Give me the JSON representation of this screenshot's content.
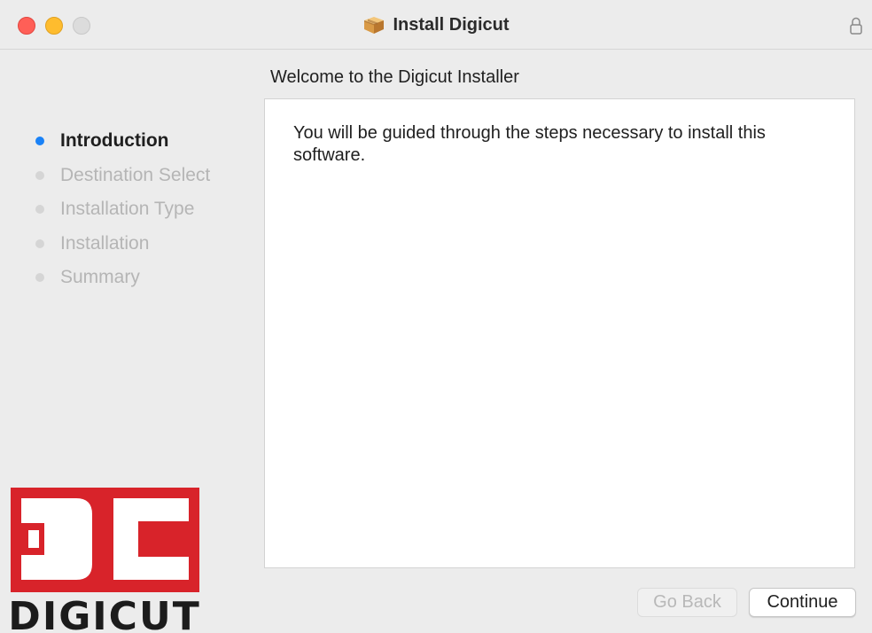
{
  "window": {
    "title": "Install Digicut"
  },
  "heading": "Welcome to the Digicut Installer",
  "steps": [
    {
      "label": "Introduction",
      "active": true
    },
    {
      "label": "Destination Select",
      "active": false
    },
    {
      "label": "Installation Type",
      "active": false
    },
    {
      "label": "Installation",
      "active": false
    },
    {
      "label": "Summary",
      "active": false
    }
  ],
  "content": {
    "text": "You will be guided through the steps necessary to install this software."
  },
  "logo": {
    "text": "DIGICUT",
    "color": "#d8232a"
  },
  "buttons": {
    "back": "Go Back",
    "continue": "Continue"
  },
  "icons": {
    "title": "package-icon",
    "lock": "lock-icon"
  },
  "colors": {
    "accent": "#1a82f7",
    "close": "#ff5f57",
    "minimize": "#febc2e"
  }
}
